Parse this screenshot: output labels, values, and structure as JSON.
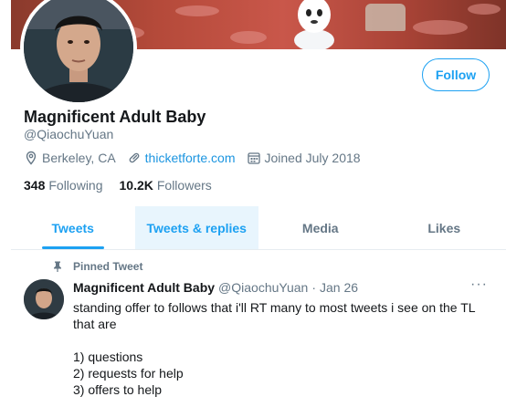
{
  "profile": {
    "name": "Magnificent Adult Baby",
    "handle": "@QiaochuYuan",
    "location": "Berkeley, CA",
    "website": "thicketforte.com",
    "joined": "Joined July 2018",
    "following_count": "348",
    "following_label": "Following",
    "followers_count": "10.2K",
    "followers_label": "Followers",
    "follow_button": "Follow"
  },
  "tabs": [
    {
      "label": "Tweets",
      "state": "active"
    },
    {
      "label": "Tweets & replies",
      "state": "hover"
    },
    {
      "label": "Media",
      "state": ""
    },
    {
      "label": "Likes",
      "state": ""
    }
  ],
  "tweet": {
    "pinned_label": "Pinned Tweet",
    "author_name": "Magnificent Adult Baby",
    "author_handle": "@QiaochuYuan",
    "date": "Jan 26",
    "separator": "·",
    "more": "···",
    "lines": [
      "standing offer to follows that i'll RT many to most tweets i see on the TL that are",
      "",
      "1) questions",
      "2) requests for help",
      "3) offers to help"
    ]
  },
  "colors": {
    "accent": "#1da1f2",
    "link": "#1b95e0",
    "muted": "#657786",
    "text": "#14171a",
    "tab_hover_bg": "#e8f5fd"
  },
  "icons": {
    "location": "location-pin-icon",
    "website": "link-icon",
    "joined": "calendar-icon",
    "pinned": "pin-icon"
  }
}
